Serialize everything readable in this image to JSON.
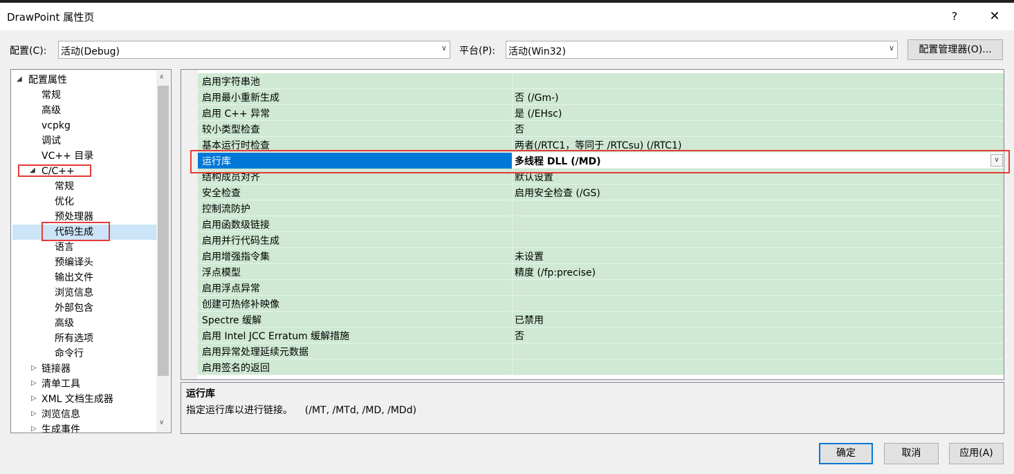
{
  "window": {
    "title": "DrawPoint 属性页",
    "help": "?",
    "close": "✕"
  },
  "config": {
    "label": "配置(C):",
    "value": "活动(Debug)"
  },
  "platform": {
    "label": "平台(P):",
    "value": "活动(Win32)"
  },
  "config_manager": "配置管理器(O)...",
  "tree": {
    "root": "配置属性",
    "items": [
      "常规",
      "高级",
      "vcpkg",
      "调试",
      "VC++ 目录"
    ],
    "cpp": "C/C++",
    "cpp_items": [
      "常规",
      "优化",
      "预处理器",
      "代码生成",
      "语言",
      "预编译头",
      "输出文件",
      "浏览信息",
      "外部包含",
      "高级",
      "所有选项",
      "命令行"
    ],
    "collapsed": [
      "链接器",
      "清单工具",
      "XML 文档生成器",
      "浏览信息",
      "生成事件"
    ]
  },
  "properties": [
    {
      "name": "启用字符串池",
      "value": ""
    },
    {
      "name": "启用最小重新生成",
      "value": "否 (/Gm-)"
    },
    {
      "name": "启用 C++ 异常",
      "value": "是 (/EHsc)"
    },
    {
      "name": "较小类型检查",
      "value": "否"
    },
    {
      "name": "基本运行时检查",
      "value": "两者(/RTC1，等同于 /RTCsu) (/RTC1)"
    },
    {
      "name": "运行库",
      "value": "多线程 DLL (/MD)"
    },
    {
      "name": "结构成员对齐",
      "value": "默认设置"
    },
    {
      "name": "安全检查",
      "value": "启用安全检查 (/GS)"
    },
    {
      "name": "控制流防护",
      "value": ""
    },
    {
      "name": "启用函数级链接",
      "value": ""
    },
    {
      "name": "启用并行代码生成",
      "value": ""
    },
    {
      "name": "启用增强指令集",
      "value": "未设置"
    },
    {
      "name": "浮点模型",
      "value": "精度 (/fp:precise)"
    },
    {
      "name": "启用浮点异常",
      "value": ""
    },
    {
      "name": "创建可热修补映像",
      "value": ""
    },
    {
      "name": "Spectre 缓解",
      "value": "已禁用"
    },
    {
      "name": "启用 Intel JCC Erratum 缓解措施",
      "value": "否"
    },
    {
      "name": "启用异常处理延续元数据",
      "value": ""
    },
    {
      "name": "启用签名的返回",
      "value": ""
    }
  ],
  "description": {
    "title": "运行库",
    "text": "指定运行库以进行链接。    (/MT, /MTd, /MD, /MDd)"
  },
  "buttons": {
    "ok": "确定",
    "cancel": "取消",
    "apply": "应用(A)"
  },
  "colors": {
    "grid_row": "#cfe9d4",
    "selection": "#0078d7",
    "highlight_box": "#e53935"
  }
}
